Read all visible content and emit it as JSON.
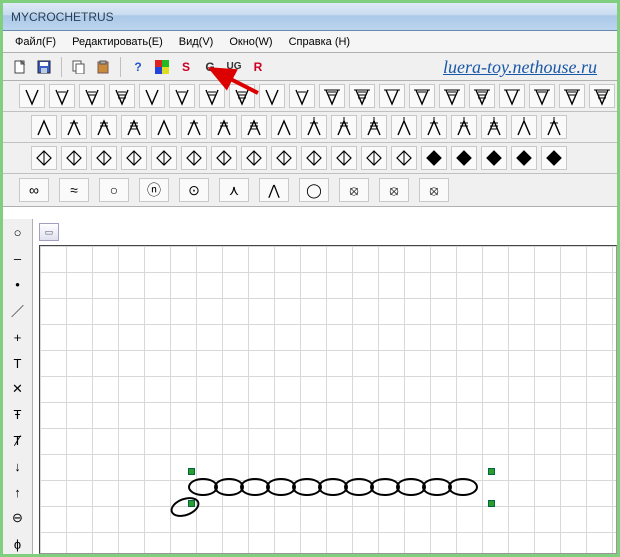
{
  "title": "MYCROCHETRUS",
  "watermark": "luera-toy.nethouse.ru",
  "menu": {
    "file": "Файл(F)",
    "edit": "Редактировать(E)",
    "view": "Вид(V)",
    "window": "Окно(W)",
    "help": "Справка (H)"
  },
  "toolbar": {
    "S": "S",
    "G": "G",
    "UG": "UG",
    "R": "R"
  },
  "symbolbar": {
    "infinity": "∞",
    "approx": "≈",
    "circle_small": "○",
    "circle_n": "ⓝ",
    "circle_dot": "⊙",
    "lambda": "⋏",
    "A_thin": "⋀",
    "oval": "◯",
    "bulb1": "⦻",
    "bulb2": "⦻",
    "bulb3": "⦻"
  },
  "chain": {
    "count": 11
  }
}
